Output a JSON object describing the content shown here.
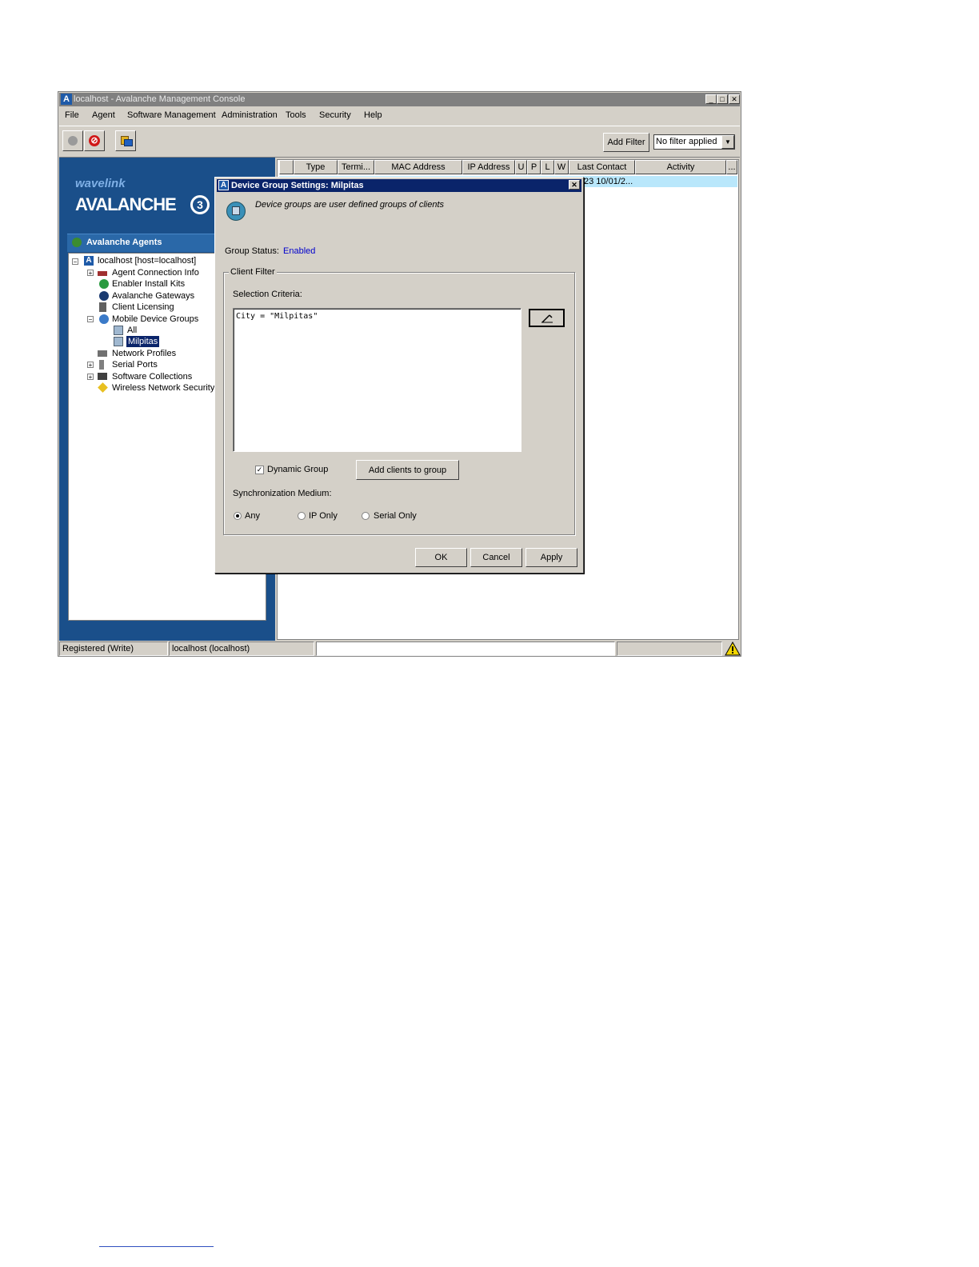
{
  "window": {
    "title": "localhost - Avalanche Management Console",
    "app_icon": "A"
  },
  "menu": [
    "File",
    "Agent",
    "Software Management",
    "Administration",
    "Tools",
    "Security",
    "Help"
  ],
  "toolbar": {
    "add_filter_label": "Add Filter",
    "filter_value": "No filter applied"
  },
  "sidebar": {
    "logo_top": "wavelink",
    "logo_main": "AVALANCHE",
    "logo_version": "3",
    "header": "Avalanche Agents",
    "tree": {
      "root": "localhost [host=localhost]",
      "items": [
        "Agent Connection Info",
        "Enabler Install Kits",
        "Avalanche Gateways",
        "Client Licensing",
        "Mobile Device Groups"
      ],
      "groups": [
        "All",
        "Milpitas"
      ],
      "more_items": [
        "Network Profiles",
        "Serial Ports",
        "Software Collections",
        "Wireless Network Security"
      ]
    }
  },
  "table": {
    "columns": [
      "",
      "Type",
      "Termi...",
      "MAC Address",
      "IP Address",
      "U",
      "P",
      "L",
      "W",
      "Last Contact",
      "Activity",
      "..."
    ],
    "row_fragment": "23 10/01/2..."
  },
  "statusbar": {
    "cell1": "Registered (Write)",
    "cell2": "localhost (localhost)",
    "cell3": "",
    "cell4": ""
  },
  "dialog": {
    "title": "Device Group Settings: Milpitas",
    "description": "Device groups are user defined groups of clients",
    "group_status_label": "Group Status:",
    "group_status_value": "Enabled",
    "client_filter_label": "Client Filter",
    "selection_criteria_label": "Selection Criteria:",
    "selection_criteria_value": "City = \"Milpitas\"",
    "dynamic_group_label": "Dynamic Group",
    "add_clients_label": "Add clients to group",
    "sync_medium_label": "Synchronization Medium:",
    "radio_any": "Any",
    "radio_ip_only": "IP Only",
    "radio_serial_only": "Serial Only",
    "ok_label": "OK",
    "cancel_label": "Cancel",
    "apply_label": "Apply"
  },
  "colors": {
    "sidebar_blue": "#1a4f8a",
    "dialog_title": "#0a246a",
    "status_enabled": "#0000cc",
    "row_highlight": "#b9e7fb"
  }
}
